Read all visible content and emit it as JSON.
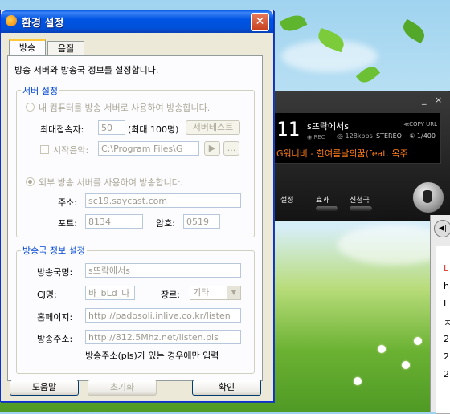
{
  "dialog": {
    "title": "환경 설정",
    "close_glyph": "✕",
    "tabs": [
      {
        "label": "방송"
      },
      {
        "label": "음질"
      }
    ],
    "intro": "방송 서버와 방송국 정보를 설정합니다.",
    "server_group": {
      "title": "서버 설정",
      "radio_local": "내 컴퓨터를 방송 서버로 사용하여 방송합니다.",
      "max_conn_label": "최대접속자:",
      "max_conn_value": "50",
      "max_conn_hint": "(최대 100명)",
      "server_test_button": "서버테스트",
      "start_music_label": "시작음악:",
      "start_music_value": "C:\\Program Files\\G",
      "play_glyph": "▶",
      "browse_glyph": "...",
      "radio_external": "외부 방송 서버를 사용하여 방송합니다.",
      "address_label": "주소:",
      "address_value": "sc19.saycast.com",
      "port_label": "포트:",
      "port_value": "8134",
      "password_label": "암호:",
      "password_value": "0519"
    },
    "station_group": {
      "title": "방송국 정보 설정",
      "name_label": "방송국명:",
      "name_value": "s뜨락에서s",
      "cj_label": "CJ명:",
      "cj_value": "바_bLd_다",
      "genre_label": "장르:",
      "genre_value": "기타",
      "homepage_label": "홈페이지:",
      "homepage_value": "http://padosoli.inlive.co.kr/listen",
      "address_label": "방송주소:",
      "address_value": "http://812.5Mhz.net/listen.pls",
      "note": "방송주소(pls)가 있는 경우에만 입력"
    },
    "buttons": {
      "help": "도움말",
      "reset": "초기화",
      "ok": "확인"
    }
  },
  "player": {
    "minimize_glyph": "_",
    "close_glyph": "×",
    "track_number": "11",
    "station": "s뜨락에서s",
    "copy_badge": "≪COPY URL",
    "rec": "◉ REC",
    "bitrate": "◎ 128kbps",
    "stereo": "STEREO",
    "listeners": "① 1/400",
    "song": "G워너비 - 한여름날의꿈(feat. 옥주",
    "buttons": [
      {
        "label": "설정"
      },
      {
        "label": "효과"
      },
      {
        "label": "신청곡"
      }
    ]
  },
  "side_panel": {
    "play_glyph": "◀|",
    "rows": [
      "L",
      "h",
      "L",
      "ㅈ",
      "2",
      "2",
      "2"
    ]
  },
  "colors": {
    "title_bar": "#0054e3",
    "dialog_bg": "#ece9d8",
    "group_title": "#0046d5",
    "song_text": "#ff7a1a"
  }
}
